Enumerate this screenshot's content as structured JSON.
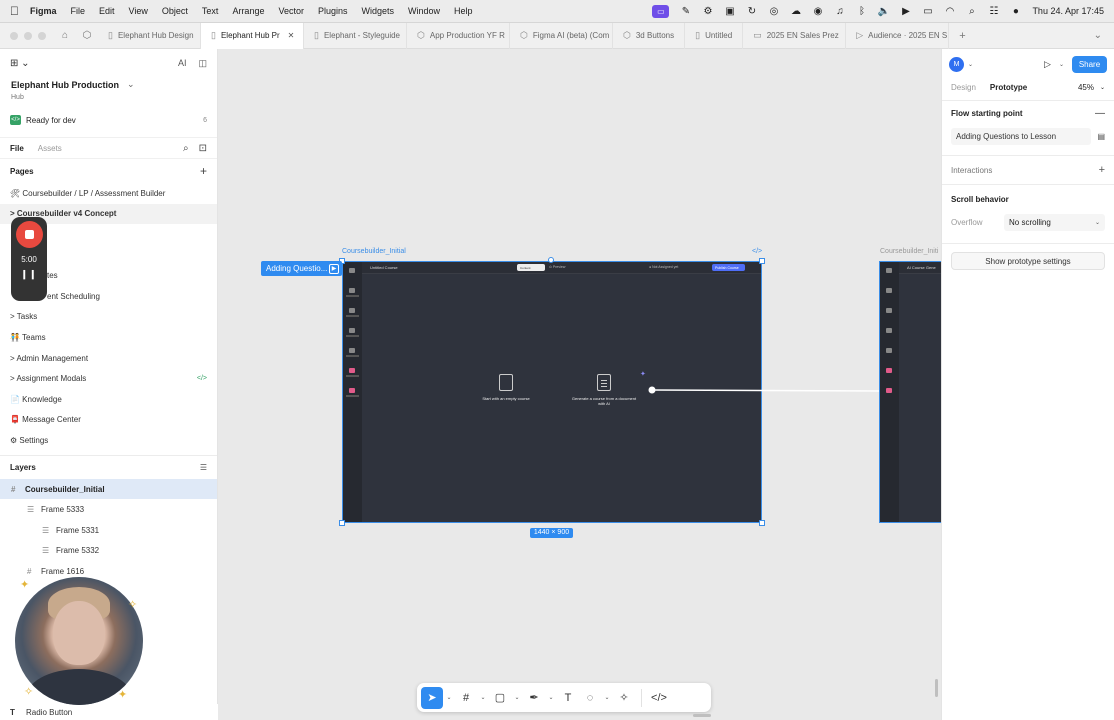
{
  "menubar": {
    "app": "Figma",
    "items": [
      "File",
      "Edit",
      "View",
      "Object",
      "Text",
      "Arrange",
      "Vector",
      "Plugins",
      "Widgets",
      "Window",
      "Help"
    ],
    "clock": "Thu 24. Apr  17:45"
  },
  "tabs": [
    {
      "label": "Elephant Hub Design",
      "active": false
    },
    {
      "label": "Elephant Hub Pr",
      "active": true
    },
    {
      "label": "Elephant - Styleguide",
      "active": false
    },
    {
      "label": "App Production YF R",
      "active": false
    },
    {
      "label": "Figma AI (beta) (Com",
      "active": false
    },
    {
      "label": "3d Buttons",
      "active": false
    },
    {
      "label": "Untitled",
      "active": false
    },
    {
      "label": "2025 EN Sales Prez",
      "active": false
    },
    {
      "label": "Audience · 2025 EN S",
      "active": false
    }
  ],
  "left_panel": {
    "file_title": "Elephant Hub Production",
    "file_sub": "Hub",
    "ready_label": "Ready for dev",
    "ready_count": "6",
    "tab_file": "File",
    "tab_assets": "Assets",
    "pages_title": "Pages",
    "pages": [
      {
        "label": "🛠 Coursebuilder / LP / Assessment Builder",
        "active": false
      },
      {
        "label": "> Coursebuilder v4 Concept",
        "active": true
      },
      {
        "label": "",
        "active": false
      },
      {
        "label": "",
        "active": false
      },
      {
        "label": "tes",
        "active": false
      },
      {
        "label": "ent Scheduling",
        "active": false
      },
      {
        "label": "> Tasks",
        "active": false
      },
      {
        "label": "🧑‍🤝‍🧑 Teams",
        "active": false
      },
      {
        "label": "> Admin Management",
        "active": false
      },
      {
        "label": "> Assignment Modals",
        "active": false,
        "code": "</>"
      },
      {
        "label": "📄 Knowledge",
        "active": false
      },
      {
        "label": "📮 Message Center",
        "active": false
      },
      {
        "label": "⚙ Settings",
        "active": false
      }
    ],
    "layers_title": "Layers",
    "layers": [
      {
        "label": "Coursebuilder_Initial",
        "indent": 0,
        "icon": "#",
        "selected": true
      },
      {
        "label": "Frame 5333",
        "indent": 1,
        "icon": "☰",
        "selected": false
      },
      {
        "label": "Frame 5331",
        "indent": 2,
        "icon": "☰",
        "selected": false
      },
      {
        "label": "Frame 5332",
        "indent": 2,
        "icon": "☰",
        "selected": false
      },
      {
        "label": "Frame 1616",
        "indent": 1,
        "icon": "#",
        "selected": false
      }
    ],
    "bottom_layer": "Radio Button",
    "bottom_layer_icon": "T"
  },
  "recorder": {
    "time": "5:00"
  },
  "canvas": {
    "frame_label": "Coursebuilder_Initial",
    "frame2_label": "Coursebuilder_Initi",
    "flow_badge": "Adding Questio...",
    "dimensions": "1440 × 900",
    "code_tag": "</>",
    "mock": {
      "title": "Untitled Course",
      "toggle": "Content",
      "preview": "⊙ Preview",
      "status": "● Not Assigned yet",
      "publish": "Publish Course",
      "option1": "Start with an empty course",
      "option2": "Generate a course from a document with AI",
      "frame2_title": "AI Course Gene"
    }
  },
  "right_panel": {
    "avatar": "M",
    "share": "Share",
    "tab_design": "Design",
    "tab_prototype": "Prototype",
    "zoom": "45%",
    "flow_title": "Flow starting point",
    "flow_name": "Adding Questions to Lesson",
    "interactions": "Interactions",
    "scroll_title": "Scroll behavior",
    "overflow_label": "Overflow",
    "overflow_value": "No scrolling",
    "proto_settings": "Show prototype settings"
  },
  "colors": {
    "accent": "#2f8bf0",
    "frame_bg": "#2f333d",
    "record": "#e8493f",
    "ready": "#35a266"
  }
}
